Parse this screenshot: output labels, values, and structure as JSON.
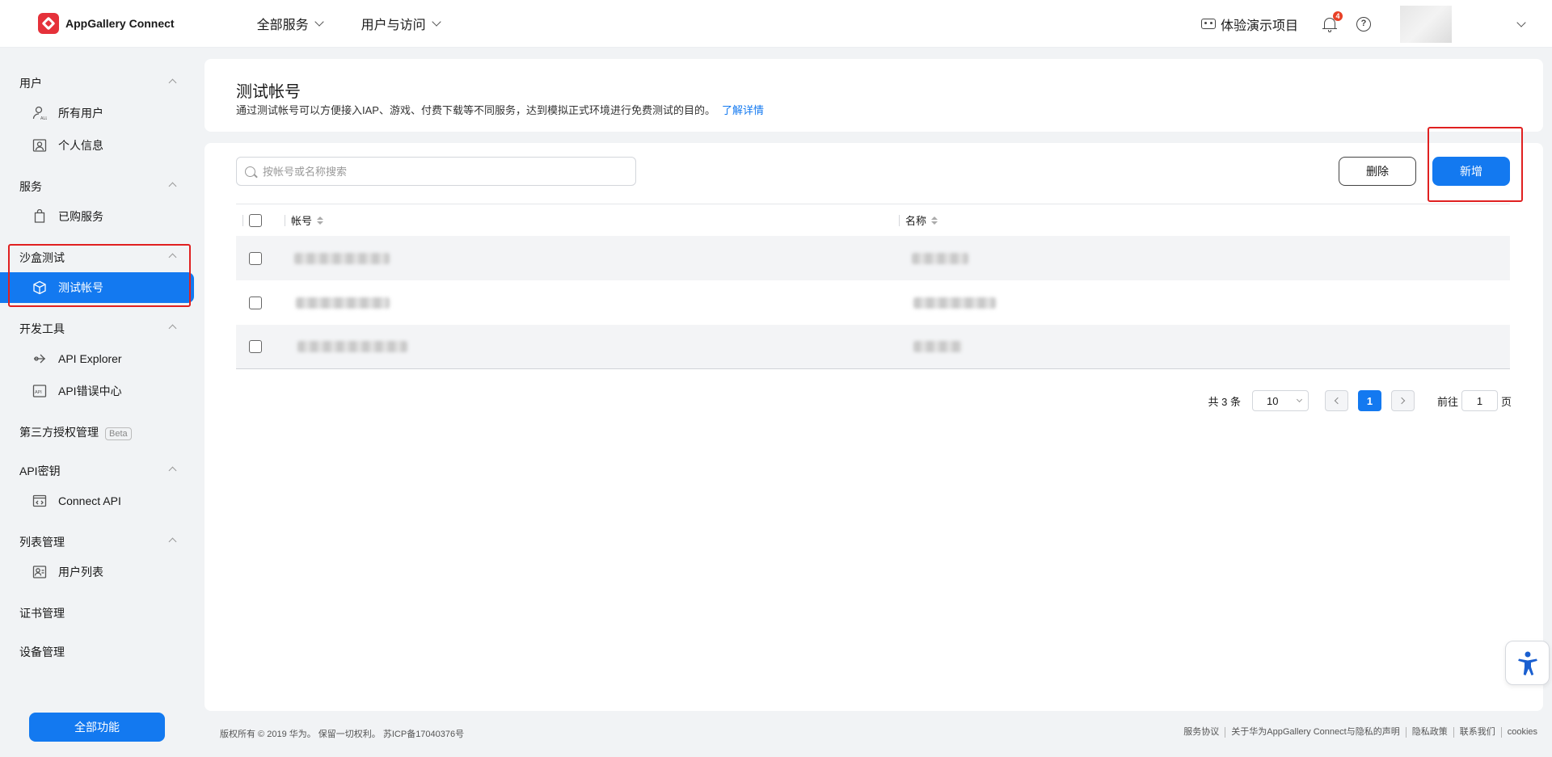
{
  "app": {
    "name": "AppGallery Connect",
    "brand_color": "#e5313a",
    "accent_color": "#1379f0"
  },
  "header": {
    "nav": [
      {
        "label": "全部服务"
      },
      {
        "label": "用户与访问"
      }
    ],
    "demo_label": "体验演示项目",
    "notification_count": "4",
    "help_icon": "?"
  },
  "sidebar": {
    "groups": [
      {
        "title": "用户",
        "items": [
          {
            "label": "所有用户",
            "icon": "user-all-icon"
          },
          {
            "label": "个人信息",
            "icon": "profile-icon"
          }
        ]
      },
      {
        "title": "服务",
        "items": [
          {
            "label": "已购服务",
            "icon": "shopping-bag-icon"
          }
        ]
      },
      {
        "title": "沙盒测试",
        "items": [
          {
            "label": "测试帐号",
            "icon": "cube-icon",
            "active": true
          }
        ]
      },
      {
        "title": "开发工具",
        "items": [
          {
            "label": "API Explorer",
            "icon": "api-explorer-icon"
          },
          {
            "label": "API错误中心",
            "icon": "api-error-icon"
          }
        ]
      },
      {
        "title": "第三方授权管理",
        "badge": "Beta"
      },
      {
        "title": "API密钥",
        "items": [
          {
            "label": "Connect API",
            "icon": "code-window-icon"
          }
        ]
      },
      {
        "title": "列表管理",
        "items": [
          {
            "label": "用户列表",
            "icon": "user-list-icon"
          }
        ]
      },
      {
        "title": "证书管理"
      },
      {
        "title": "设备管理"
      }
    ],
    "all_functions_label": "全部功能"
  },
  "page": {
    "title": "测试帐号",
    "description": "通过测试帐号可以方便接入IAP、游戏、付费下载等不同服务，达到模拟正式环境进行免费测试的目的。",
    "learn_more": "了解详情"
  },
  "toolbar": {
    "search_placeholder": "按帐号或名称搜索",
    "delete_label": "删除",
    "add_label": "新增"
  },
  "table": {
    "columns": [
      "帐号",
      "名称"
    ],
    "rows": [
      {
        "account": "",
        "name": ""
      },
      {
        "account": "",
        "name": ""
      },
      {
        "account": "",
        "name": ""
      }
    ]
  },
  "pagination": {
    "total_label": "共 3 条",
    "page_size": "10",
    "current_page": "1",
    "goto_label": "前往",
    "goto_value": "1",
    "page_suffix": "页"
  },
  "footer": {
    "copyright": "版权所有 © 2019 华为。 保留一切权利。 苏ICP备17040376号",
    "links": [
      "服务协议",
      "关于华为AppGallery Connect与隐私的声明",
      "隐私政策",
      "联系我们",
      "cookies"
    ]
  }
}
